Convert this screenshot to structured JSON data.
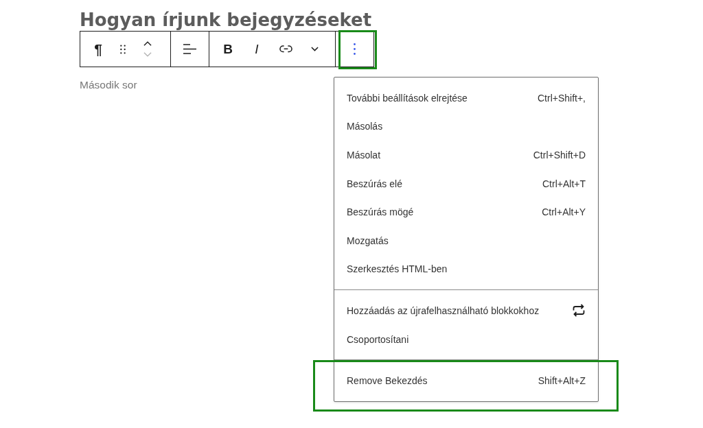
{
  "post_title": "Hogyan írjunk bejegyzéseket",
  "block_toolbar": {
    "block_type_symbol": "¶",
    "move_up": {
      "disabled": false
    },
    "move_down": {
      "disabled": true
    },
    "bold_label": "B",
    "italic_label": "I",
    "more_options": {
      "expanded": true,
      "highlighted": true
    }
  },
  "paragraph": {
    "text": "Második sor"
  },
  "menu": {
    "groups": [
      {
        "highlighted": false,
        "items": [
          {
            "kind": "shortcut",
            "label": "További beállítások elrejtése",
            "shortcut": "Ctrl+Shift+,"
          },
          {
            "kind": "plain",
            "label": "Másolás"
          },
          {
            "kind": "shortcut",
            "label": "Másolat",
            "shortcut": "Ctrl+Shift+D"
          },
          {
            "kind": "shortcut",
            "label": "Beszúrás elé",
            "shortcut": "Ctrl+Alt+T"
          },
          {
            "kind": "shortcut",
            "label": "Beszúrás mögé",
            "shortcut": "Ctrl+Alt+Y"
          },
          {
            "kind": "plain",
            "label": "Mozgatás"
          },
          {
            "kind": "plain",
            "label": "Szerkesztés HTML-ben"
          }
        ]
      },
      {
        "highlighted": false,
        "items": [
          {
            "kind": "icon",
            "label": "Hozzáadás az újrafelhasználható blokkokhoz"
          },
          {
            "kind": "plain",
            "label": "Csoportosítani"
          }
        ]
      },
      {
        "highlighted": true,
        "items": [
          {
            "kind": "shortcut",
            "label": "Remove Bekezdés",
            "shortcut": "Shift+Alt+Z"
          }
        ]
      }
    ]
  }
}
